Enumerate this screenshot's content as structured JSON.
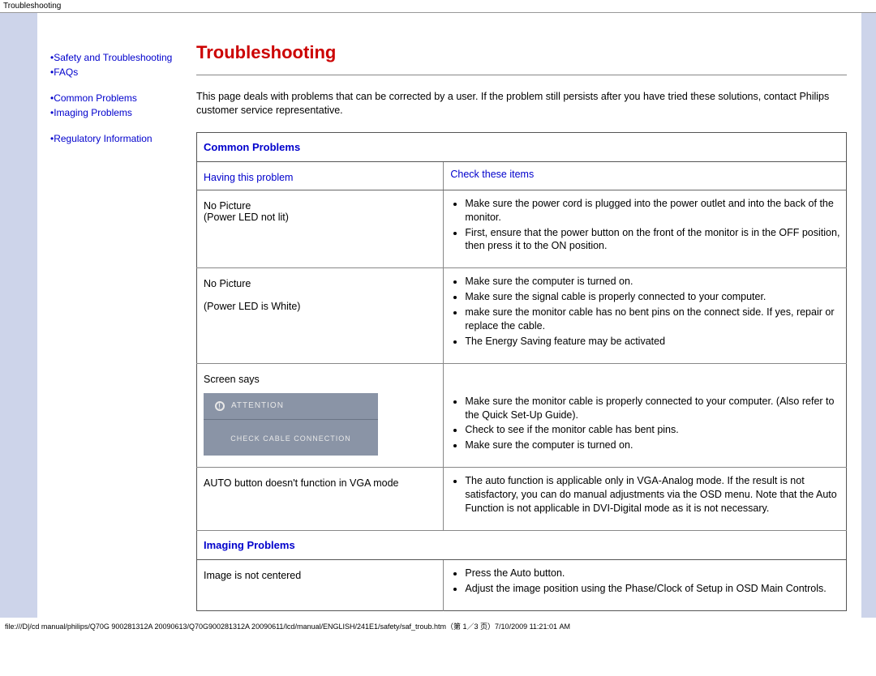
{
  "header": "Troubleshooting",
  "sidebar": {
    "items": [
      {
        "bullet": "•",
        "label": "Safety and Troubleshooting"
      },
      {
        "bullet": "•",
        "label": "FAQs"
      },
      {
        "bullet": "•",
        "label": "Common Problems"
      },
      {
        "bullet": "•",
        "label": "Imaging Problems"
      },
      {
        "bullet": "•",
        "label": "Regulatory Information"
      }
    ]
  },
  "title": "Troubleshooting",
  "intro": "This page deals with problems that can be corrected by a user. If the problem still persists after you have tried these solutions, contact Philips customer service representative.",
  "section1": "Common Problems",
  "col1": "Having this problem",
  "col2": "Check these items",
  "rows": [
    {
      "problem_line1": "No Picture",
      "problem_line2": "(Power LED not lit)",
      "checks": [
        "Make sure the power cord is plugged into the power outlet and into the back of the monitor.",
        "First, ensure that the power button on the front of the monitor is in the OFF position, then press it to the ON position."
      ]
    },
    {
      "problem_line1": "No Picture",
      "problem_line2": "(Power LED is White)",
      "checks": [
        "Make sure the computer is turned on.",
        "Make sure the signal cable is properly connected to your computer.",
        "make sure the monitor cable has no bent pins on the connect side. If yes, repair or replace the cable.",
        "The Energy Saving feature may be activated"
      ]
    },
    {
      "problem_line1": "Screen says",
      "attention_label": "ATTENTION",
      "attention_body": "CHECK CABLE CONNECTION",
      "checks": [
        "Make sure the monitor cable is properly connected to your computer. (Also refer to the Quick Set-Up Guide).",
        "Check to see if the monitor cable has bent pins.",
        "Make sure the computer is turned on."
      ]
    },
    {
      "problem_line1": "AUTO button doesn't function in VGA mode",
      "checks": [
        "The auto function is applicable only in VGA-Analog mode.  If the result is not satisfactory, you can do manual adjustments via the OSD menu.  Note that the Auto Function is not applicable in DVI-Digital mode as it is not necessary."
      ]
    }
  ],
  "section2": "Imaging Problems",
  "rows2": [
    {
      "problem_line1": "Image is not centered",
      "checks": [
        "Press the Auto button.",
        "Adjust the image position using the Phase/Clock of Setup in OSD Main Controls."
      ]
    }
  ],
  "footer": "file:///D|/cd manual/philips/Q70G 900281312A 20090613/Q70G900281312A 20090611/lcd/manual/ENGLISH/241E1/safety/saf_troub.htm（第 1／3 页）7/10/2009 11:21:01 AM"
}
